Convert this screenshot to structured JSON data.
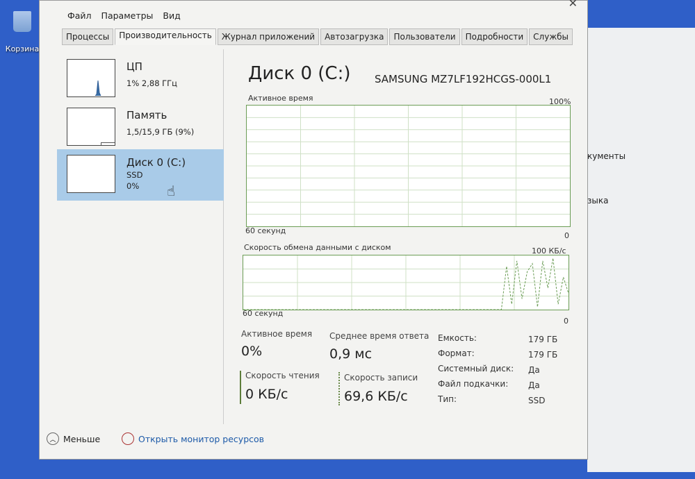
{
  "desktop": {
    "recycle_bin": "Корзина"
  },
  "background_window": {
    "line1": "кументы",
    "line2": "зыка"
  },
  "menu": [
    "Файл",
    "Параметры",
    "Вид"
  ],
  "tabs": [
    "Процессы",
    "Производительность",
    "Журнал приложений",
    "Автозагрузка",
    "Пользователи",
    "Подробности",
    "Службы"
  ],
  "active_tab": 1,
  "sidebar": [
    {
      "name": "ЦП",
      "line1": "1% 2,88 ГГц"
    },
    {
      "name": "Память",
      "line1": "1,5/15,9 ГБ (9%)"
    },
    {
      "name": "Диск 0 (C:)",
      "line1": "SSD",
      "line2": "0%"
    }
  ],
  "main": {
    "title": "Диск 0 (C:)",
    "model": "SAMSUNG MZ7LF192HCGS-000L1",
    "graph1": {
      "label": "Активное время",
      "max": "100%",
      "time": "60 секунд",
      "min": "0"
    },
    "graph2": {
      "label": "Скорость обмена данными с диском",
      "max": "100 КБ/с",
      "time": "60 секунд",
      "min": "0"
    },
    "write_samples": [
      0,
      0,
      0,
      0,
      0,
      0,
      0,
      0,
      0,
      0,
      0,
      0,
      0,
      0,
      0,
      0,
      0,
      0,
      0,
      0,
      0,
      0,
      0,
      0,
      0,
      0,
      0,
      0,
      0,
      0,
      0,
      0,
      0,
      0,
      0,
      0,
      0,
      0,
      0,
      0,
      0,
      0,
      0,
      0,
      0,
      0,
      0,
      0,
      0,
      0,
      0,
      80,
      10,
      90,
      20,
      70,
      85,
      5,
      90,
      40,
      95,
      10,
      60,
      30
    ],
    "stats": {
      "active_label": "Активное время",
      "active_value": "0%",
      "resp_label": "Среднее время ответа",
      "resp_value": "0,9 мс",
      "read_label": "Скорость чтения",
      "read_value": "0 КБ/с",
      "write_label": "Скорость записи",
      "write_value": "69,6 КБ/с"
    },
    "props": [
      {
        "k": "Емкость:",
        "v": "179 ГБ"
      },
      {
        "k": "Формат:",
        "v": "179 ГБ"
      },
      {
        "k": "Системный диск:",
        "v": "Да"
      },
      {
        "k": "Файл подкачки:",
        "v": "Да"
      },
      {
        "k": "Тип:",
        "v": "SSD"
      }
    ]
  },
  "footer": {
    "less": "Меньше",
    "monitor": "Открыть монитор ресурсов"
  }
}
